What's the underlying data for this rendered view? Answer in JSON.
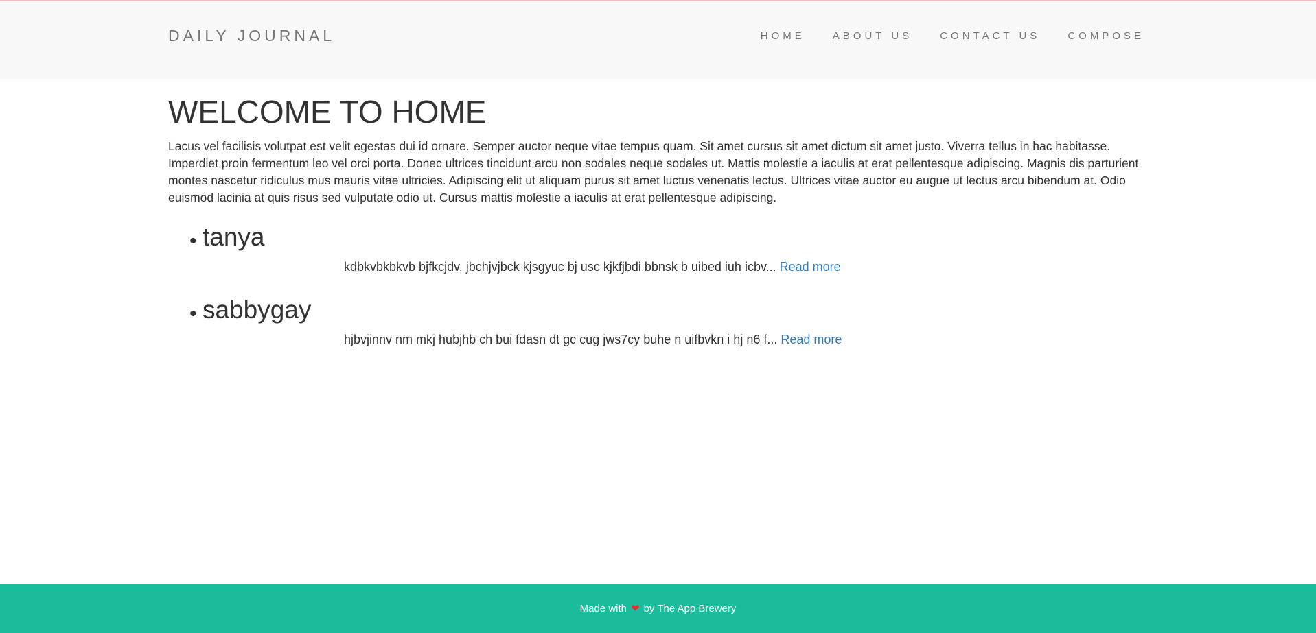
{
  "header": {
    "brand": "DAILY JOURNAL",
    "nav": [
      {
        "label": "HOME"
      },
      {
        "label": "ABOUT US"
      },
      {
        "label": "CONTACT US"
      },
      {
        "label": "COMPOSE"
      }
    ]
  },
  "main": {
    "title": "WELCOME TO HOME",
    "intro": "Lacus vel facilisis volutpat est velit egestas dui id ornare. Semper auctor neque vitae tempus quam. Sit amet cursus sit amet dictum sit amet justo. Viverra tellus in hac habitasse. Imperdiet proin fermentum leo vel orci porta. Donec ultrices tincidunt arcu non sodales neque sodales ut. Mattis molestie a iaculis at erat pellentesque adipiscing. Magnis dis parturient montes nascetur ridiculus mus mauris vitae ultricies. Adipiscing elit ut aliquam purus sit amet luctus venenatis lectus. Ultrices vitae auctor eu augue ut lectus arcu bibendum at. Odio euismod lacinia at quis risus sed vulputate odio ut. Cursus mattis molestie a iaculis at erat pellentesque adipiscing.",
    "posts": [
      {
        "title": "tanya",
        "excerpt": "kdbkvbkbkvb bjfkcjdv, jbchjvjbck kjsgyuc bj usc kjkfjbdi bbnsk b uibed iuh icbv...",
        "read_more": "Read more"
      },
      {
        "title": "sabbygay",
        "excerpt": "hjbvjinnv nm mkj hubjhb ch bui fdasn dt gc cug jws7cy buhe n uifbvkn i hj n6 f...",
        "read_more": "Read more"
      }
    ]
  },
  "footer": {
    "made_with": "Made with",
    "heart_icon": "heart-icon",
    "by": "by The App Brewery"
  },
  "colors": {
    "navbar_bg": "#f8f8f8",
    "footer_bg": "#1abc9c",
    "link": "#337ab7",
    "heart": "#e03131"
  }
}
